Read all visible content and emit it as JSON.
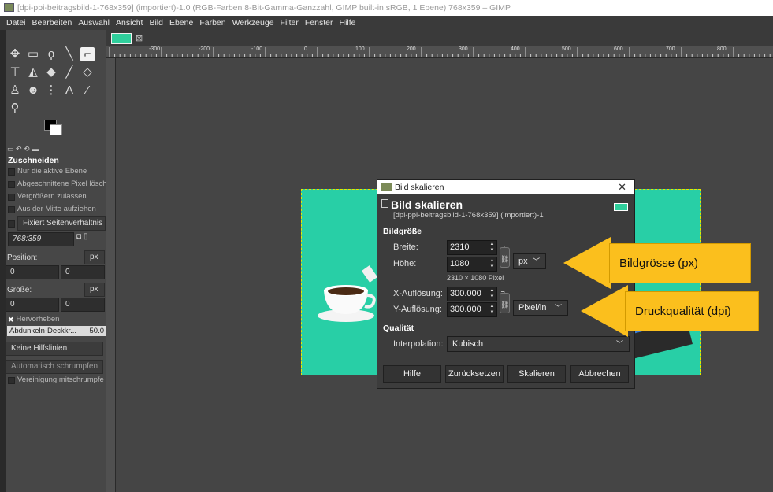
{
  "window": {
    "title": "[dpi-ppi-beitragsbild-1-768x359] (importiert)-1.0 (RGB-Farben 8-Bit-Gamma-Ganzzahl, GIMP built-in sRGB, 1 Ebene) 768x359 – GIMP"
  },
  "menu": [
    "Datei",
    "Bearbeiten",
    "Auswahl",
    "Ansicht",
    "Bild",
    "Ebene",
    "Farben",
    "Werkzeuge",
    "Filter",
    "Fenster",
    "Hilfe"
  ],
  "tool_options": {
    "title": "Zuschneiden",
    "checks": [
      "Nur die aktive Ebene",
      "Abgeschnittene Pixel lösch",
      "Vergrößern zulassen",
      "Aus der Mitte aufziehen"
    ],
    "fixed": "Fixiert  Seitenverhältnis",
    "ratio": "768:359",
    "position_label": "Position:",
    "position_unit": "px",
    "position_x": "0",
    "position_y": "0",
    "size_label": "Größe:",
    "size_unit": "px",
    "size_w": "0",
    "size_h": "0",
    "highlight": "Hervorheben",
    "darken": "Abdunkeln-Deckkr...",
    "darken_value": "50.0",
    "guides": "Keine Hilfslinien",
    "auto_shrink": "Automatisch schrumpfen",
    "merge": "Vereinigung mitschrumpfe"
  },
  "ruler_ticks": [
    "-300",
    "-200",
    "-100",
    "0",
    "100",
    "200",
    "300",
    "400",
    "500",
    "600",
    "700",
    "800"
  ],
  "dialog": {
    "window_title": "Bild skalieren",
    "heading": "Bild skalieren",
    "subheading": "[dpi-ppi-beitragsbild-1-768x359] (importiert)-1",
    "section_size": "Bildgröße",
    "width_label": "Breite:",
    "width_value": "2310",
    "height_label": "Höhe:",
    "height_value": "1080",
    "unit": "px",
    "size_note": "2310 × 1080 Pixel",
    "xres_label": "X-Auflösung:",
    "xres_value": "300.000",
    "yres_label": "Y-Auflösung:",
    "yres_value": "300.000",
    "res_unit": "Pixel/in",
    "section_quality": "Qualität",
    "interp_label": "Interpolation:",
    "interp_value": "Kubisch",
    "btn_help": "Hilfe",
    "btn_reset": "Zurücksetzen",
    "btn_scale": "Skalieren",
    "btn_cancel": "Abbrechen"
  },
  "callouts": {
    "size": "Bildgrösse (px)",
    "print": "Druckqualität (dpi)"
  },
  "colors": {
    "callout": "#fbbf1d",
    "image_bg": "#28cfa6",
    "selection": "#e6e600"
  }
}
